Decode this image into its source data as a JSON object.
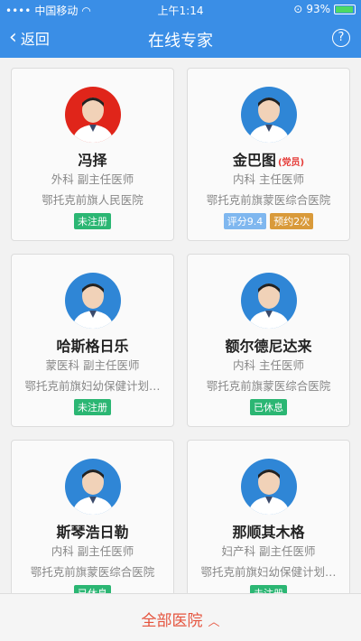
{
  "status_bar": {
    "carrier": "中国移动",
    "time": "上午1:14",
    "battery": "93%",
    "battery_level": 0.93
  },
  "nav": {
    "back_label": "返回",
    "title": "在线专家"
  },
  "doctors": [
    {
      "name": "冯择",
      "tag": "",
      "dept_title": "外科   副主任医师",
      "hospital": "鄂托克前旗人民医院",
      "badges": [
        {
          "text": "未注册",
          "color": "green"
        }
      ],
      "avatar_bg": "#e0251a"
    },
    {
      "name": "金巴图",
      "tag": "(党员)",
      "dept_title": "内科   主任医师",
      "hospital": "鄂托克前旗蒙医综合医院",
      "badges": [
        {
          "text": "评分9.4",
          "color": "blue"
        },
        {
          "text": "预约2次",
          "color": "orange"
        }
      ],
      "avatar_bg": "#2f86d6"
    },
    {
      "name": "哈斯格日乐",
      "tag": "",
      "dept_title": "蒙医科   副主任医师",
      "hospital": "鄂托克前旗妇幼保健计划…",
      "badges": [
        {
          "text": "未注册",
          "color": "green"
        }
      ],
      "avatar_bg": "#2f86d6"
    },
    {
      "name": "额尔德尼达来",
      "tag": "",
      "dept_title": "内科   主任医师",
      "hospital": "鄂托克前旗蒙医综合医院",
      "badges": [
        {
          "text": "已休息",
          "color": "green"
        }
      ],
      "avatar_bg": "#2f86d6"
    },
    {
      "name": "斯琴浩日勒",
      "tag": "",
      "dept_title": "内科   副主任医师",
      "hospital": "鄂托克前旗蒙医综合医院",
      "badges": [
        {
          "text": "已休息",
          "color": "green"
        }
      ],
      "avatar_bg": "#2f86d6"
    },
    {
      "name": "那顺其木格",
      "tag": "",
      "dept_title": "妇产科   副主任医师",
      "hospital": "鄂托克前旗妇幼保健计划…",
      "badges": [
        {
          "text": "未注册",
          "color": "green"
        }
      ],
      "avatar_bg": "#2f86d6"
    }
  ],
  "bottom": {
    "label": "全部医院",
    "caret": "^"
  }
}
